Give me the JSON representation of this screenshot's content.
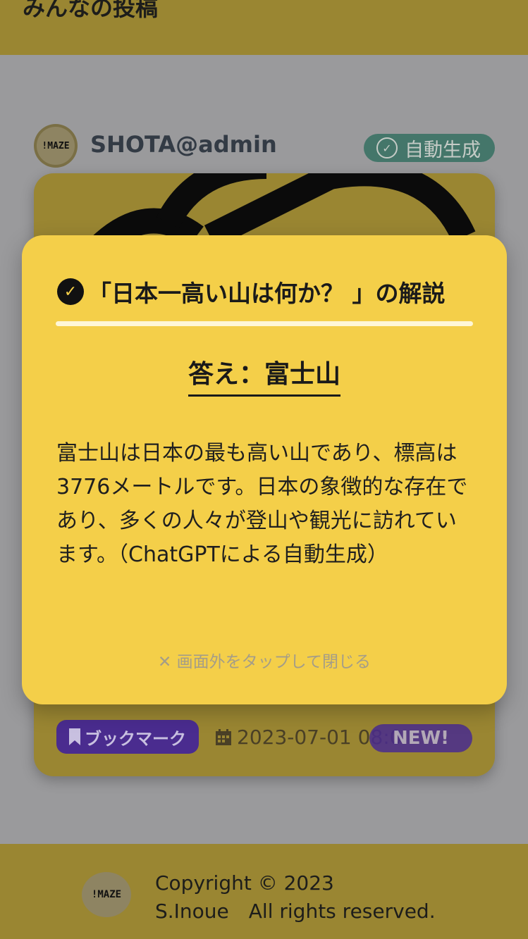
{
  "header": {
    "title": "みんなの投稿"
  },
  "post": {
    "avatar_text": "!MAZE",
    "username": "SHOTA@admin",
    "auto_badge": "自動生成",
    "bookmark_label": "ブックマーク",
    "date": "2023-07-01 08:0",
    "new_badge": "NEW!"
  },
  "modal": {
    "title": "「日本一高い山は何か？ 」の解説",
    "answer": "答え：富士山",
    "explanation": "富士山は日本の最も高い山であり、標高は3776メートルです。日本の象徴的な存在であり、多くの人々が登山や観光に訪れています。（ChatGPTによる自動生成）",
    "close_hint": "画面外をタップして閉じる"
  },
  "footer": {
    "logo_text": "!MAZE",
    "copyright": "Copyright © 2023",
    "rights": "S.Inoue　All rights reserved."
  },
  "colors": {
    "brand": "#9a8632",
    "modal": "#f4cf49",
    "accent": "#4a2c8f",
    "teal": "#44766a"
  }
}
